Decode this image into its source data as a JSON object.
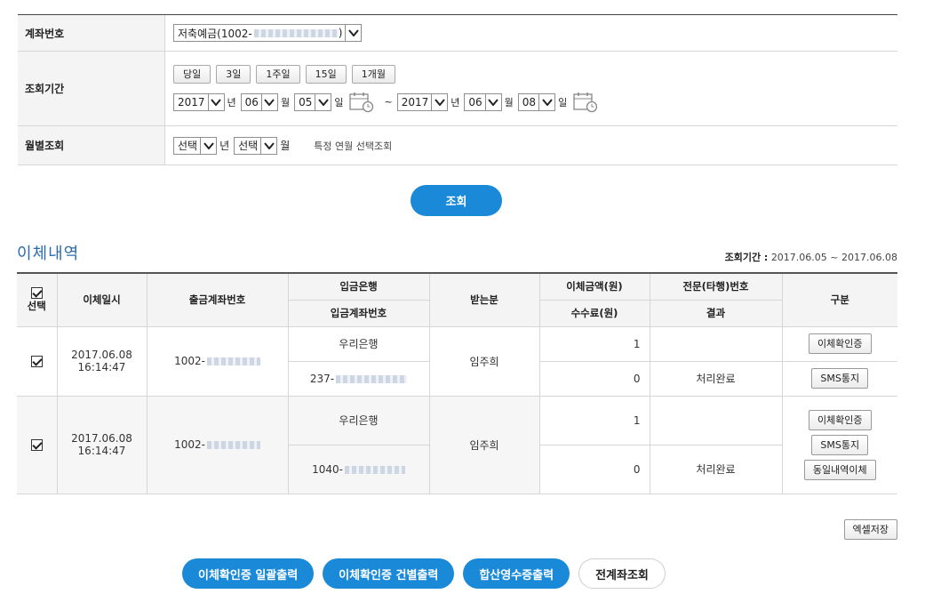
{
  "form": {
    "account": {
      "label": "계좌번호",
      "value": "저축예금(1002-"
    },
    "period": {
      "label": "조회기간",
      "quick_buttons": [
        "당일",
        "3일",
        "1주일",
        "15일",
        "1개월"
      ],
      "from": {
        "year": "2017",
        "month": "06",
        "day": "05"
      },
      "to": {
        "year": "2017",
        "month": "06",
        "day": "08"
      },
      "unit_year": "년",
      "unit_month": "월",
      "unit_day": "일",
      "tilde": "~"
    },
    "monthly": {
      "label": "월별조회",
      "year": "선택",
      "month": "선택",
      "unit_year": "년",
      "unit_month": "월",
      "hint": "특정 연월 선택조회"
    }
  },
  "query_button": "조회",
  "section_title": "이체내역",
  "period_summary": {
    "label": "조회기간 :",
    "value": "2017.06.05 ~ 2017.06.08"
  },
  "table": {
    "headers": {
      "select": "선택",
      "datetime": "이체일시",
      "from_account": "출금계좌번호",
      "bank": "입금은행",
      "to_account": "입금계좌번호",
      "recipient": "받는분",
      "amount": "이체금액(원)",
      "fee": "수수료(원)",
      "ref_no": "전문(타행)번호",
      "result": "결과",
      "category": "구분"
    },
    "rows": [
      {
        "date": "2017.06.08",
        "time": "16:14:47",
        "from_account": "1002-",
        "bank": "우리은행",
        "to_account": "237-",
        "recipient": "임주희",
        "amount": "1",
        "fee": "0",
        "result": "처리완료",
        "actions": [
          "이체확인증",
          "SMS통지"
        ]
      },
      {
        "date": "2017.06.08",
        "time": "16:14:47",
        "from_account": "1002-",
        "bank": "우리은행",
        "to_account": "1040-",
        "recipient": "임주희",
        "amount": "1",
        "fee": "0",
        "result": "처리완료",
        "actions": [
          "이체확인증",
          "SMS통지",
          "동일내역이체"
        ]
      }
    ]
  },
  "excel_button": "엑셀저장",
  "bottom_buttons": [
    "이체확인증 일괄출력",
    "이체확인증 건별출력",
    "합산영수증출력",
    "전계좌조회"
  ]
}
